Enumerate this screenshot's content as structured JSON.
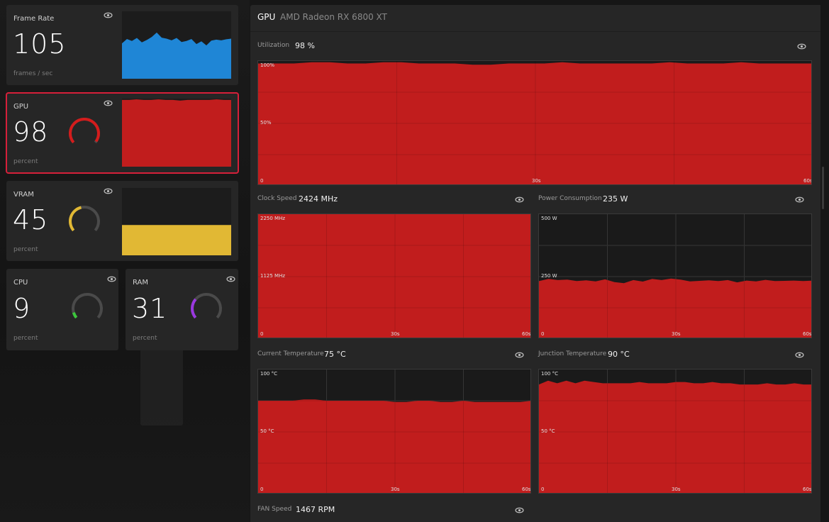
{
  "tiles": {
    "framerate": {
      "title": "Frame Rate",
      "value": "105",
      "unit": "frames / sec",
      "color": "#1f86d6"
    },
    "gpu": {
      "title": "GPU",
      "value": "98",
      "unit": "percent",
      "color": "#d41c1c",
      "gauge": 0.98
    },
    "vram": {
      "title": "VRAM",
      "value": "45",
      "unit": "percent",
      "color": "#e1b834",
      "gauge": 0.45
    },
    "cpu": {
      "title": "CPU",
      "value": "9",
      "unit": "percent",
      "color": "#3cc63c",
      "gauge": 0.09
    },
    "ram": {
      "title": "RAM",
      "value": "31",
      "unit": "percent",
      "color": "#9a38e0",
      "gauge": 0.31
    }
  },
  "panel": {
    "title": "GPU",
    "subtitle": "AMD Radeon RX 6800 XT",
    "utilization": {
      "label": "Utilization",
      "value": "98 %",
      "ticks": {
        "top": "100%",
        "mid": "50%",
        "bottom": "0",
        "x_mid": "30s",
        "x_end": "60s"
      }
    },
    "clock": {
      "label": "Clock Speed",
      "value": "2424 MHz",
      "ticks": {
        "top": "2250 MHz",
        "mid": "1125 MHz",
        "bottom": "0",
        "x_mid": "30s",
        "x_end": "60s"
      }
    },
    "power": {
      "label": "Power Consumption",
      "value": "235 W",
      "ticks": {
        "top": "500 W",
        "mid": "250 W",
        "bottom": "0",
        "x_mid": "30s",
        "x_end": "60s"
      }
    },
    "temp": {
      "label": "Current Temperature",
      "value": "75 °C",
      "ticks": {
        "top": "100 °C",
        "mid": "50 °C",
        "bottom": "0",
        "x_mid": "30s",
        "x_end": "60s"
      }
    },
    "junction": {
      "label": "Junction Temperature",
      "value": "90 °C",
      "ticks": {
        "top": "100 °C",
        "mid": "50 °C",
        "bottom": "0",
        "x_mid": "30s",
        "x_end": "60s"
      }
    },
    "fan": {
      "label": "FAN Speed",
      "value": "1467 RPM"
    }
  },
  "colors": {
    "accent": "#c11d1d",
    "fps": "#1f86d6"
  },
  "chart_data": [
    {
      "type": "area",
      "name": "fps",
      "ylim": [
        0,
        200
      ],
      "values": [
        105,
        118,
        112,
        121,
        108,
        115,
        124,
        137,
        122,
        119,
        114,
        121,
        109,
        112,
        118,
        103,
        111,
        99,
        113,
        116,
        114,
        117,
        119
      ]
    },
    {
      "type": "area",
      "name": "gpu_tile",
      "ylim": [
        0,
        100
      ],
      "values": [
        98,
        98,
        99,
        98,
        98,
        99,
        98,
        98,
        97,
        98,
        98,
        98,
        98,
        99,
        98,
        98
      ]
    },
    {
      "type": "area",
      "name": "vram_tile",
      "ylim": [
        0,
        100
      ],
      "values": [
        45,
        45,
        45,
        45,
        45,
        45,
        45,
        45
      ]
    },
    {
      "type": "area",
      "name": "utilization",
      "ylim": [
        0,
        100
      ],
      "values": [
        98,
        98,
        98,
        99,
        99,
        98,
        98,
        99,
        99,
        98,
        98,
        98,
        97,
        97,
        98,
        98,
        98,
        99,
        98,
        98,
        98,
        98,
        98,
        99,
        98,
        98,
        98,
        99,
        98,
        98,
        98,
        98
      ]
    },
    {
      "type": "area",
      "name": "clock",
      "ylim": [
        0,
        2250
      ],
      "values": [
        2424,
        2424,
        2424,
        2424,
        2424,
        2424,
        2424,
        2424
      ]
    },
    {
      "type": "area",
      "name": "power",
      "ylim": [
        0,
        500
      ],
      "values": [
        232,
        241,
        236,
        238,
        232,
        235,
        231,
        239,
        228,
        224,
        236,
        230,
        241,
        236,
        242,
        238,
        231,
        233,
        235,
        232,
        236,
        227,
        234,
        231,
        237,
        232,
        233,
        234,
        232,
        234
      ]
    },
    {
      "type": "area",
      "name": "temp",
      "ylim": [
        0,
        100
      ],
      "values": [
        75,
        75,
        75,
        75,
        76,
        76,
        75,
        75,
        75,
        75,
        75,
        75,
        74,
        74,
        75,
        75,
        74,
        74,
        75,
        74,
        74,
        74,
        74,
        74,
        75
      ]
    },
    {
      "type": "area",
      "name": "junction",
      "ylim": [
        0,
        100
      ],
      "values": [
        88,
        91,
        89,
        91,
        89,
        91,
        90,
        89,
        89,
        89,
        89,
        90,
        89,
        89,
        89,
        90,
        90,
        89,
        89,
        90,
        89,
        89,
        88,
        88,
        88,
        89,
        88,
        88,
        89,
        88,
        88
      ]
    }
  ]
}
